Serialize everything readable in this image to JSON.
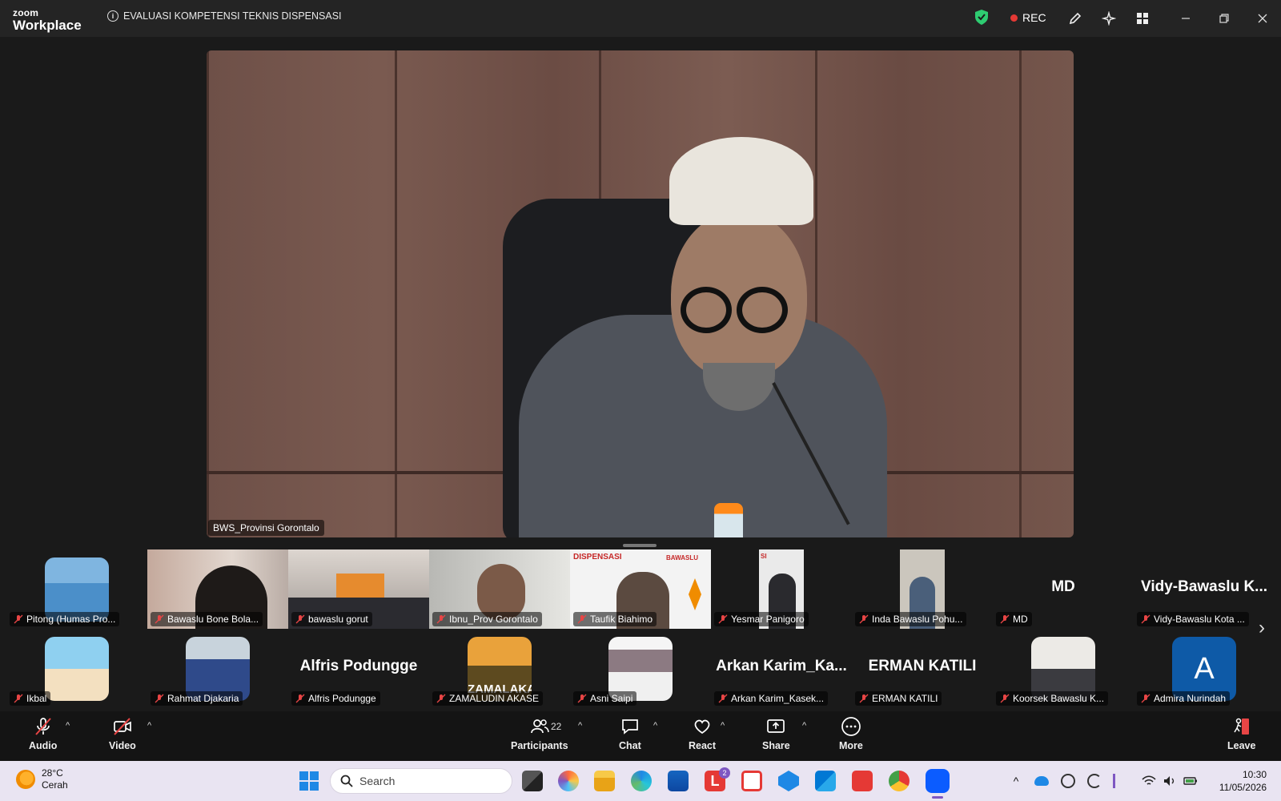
{
  "app": {
    "brand_top": "zoom",
    "brand_bottom": "Workplace",
    "meeting_title": "EVALUASI KOMPETENSI TEKNIS DISPENSASI",
    "rec_label": "REC",
    "colors": {
      "rec": "#e53935",
      "shield": "#2ecc71",
      "accent": "#0b5cff"
    }
  },
  "main_speaker": {
    "name": "BWS_Provinsi Gorontalo"
  },
  "gallery": [
    {
      "name": "Pitong (Humas Pro...",
      "type": "avatar"
    },
    {
      "name": "Bawaslu Bone Bola...",
      "type": "video"
    },
    {
      "name": "bawaslu gorut",
      "type": "video"
    },
    {
      "name": "Ibnu_Prov Gorontalo",
      "type": "video"
    },
    {
      "name": "Taufik Biahimo",
      "type": "video",
      "overlay": "DISPENSASI",
      "overlay2": "BAWASLU"
    },
    {
      "name": "Yesmar Panigoro",
      "type": "video",
      "overlay": "SI"
    },
    {
      "name": "Inda Bawaslu Pohu...",
      "type": "video"
    },
    {
      "name": "MD",
      "type": "name",
      "display": "MD"
    },
    {
      "name": "Vidy-Bawaslu Kota ...",
      "type": "name",
      "display": "Vidy-Bawaslu  K..."
    },
    {
      "name": "Ikbal",
      "type": "avatar"
    },
    {
      "name": "Rahmat Djakaria",
      "type": "avatar"
    },
    {
      "name": "Alfris Podungge",
      "type": "name",
      "display": "Alfris Podungge"
    },
    {
      "name": "ZAMALUDIN AKASE",
      "type": "avatar",
      "overlay": "ZAMALAKA"
    },
    {
      "name": "Asni Saipi",
      "type": "avatar"
    },
    {
      "name": "Arkan Karim_Kasek...",
      "type": "name",
      "display": "Arkan  Karim_Ka..."
    },
    {
      "name": "ERMAN KATILI",
      "type": "name",
      "display": "ERMAN KATILI"
    },
    {
      "name": "Koorsek Bawaslu K...",
      "type": "avatar"
    },
    {
      "name": "Admira Nurindah",
      "type": "letter",
      "display": "A"
    }
  ],
  "toolbar": {
    "audio": "Audio",
    "video": "Video",
    "participants": "Participants",
    "participant_count": "22",
    "chat": "Chat",
    "react": "React",
    "share": "Share",
    "more": "More",
    "leave": "Leave"
  },
  "taskbar": {
    "temperature": "28°C",
    "condition": "Cerah",
    "search_placeholder": "Search",
    "time": "10:30",
    "date": "11/05/2026",
    "badge_count": "2"
  }
}
